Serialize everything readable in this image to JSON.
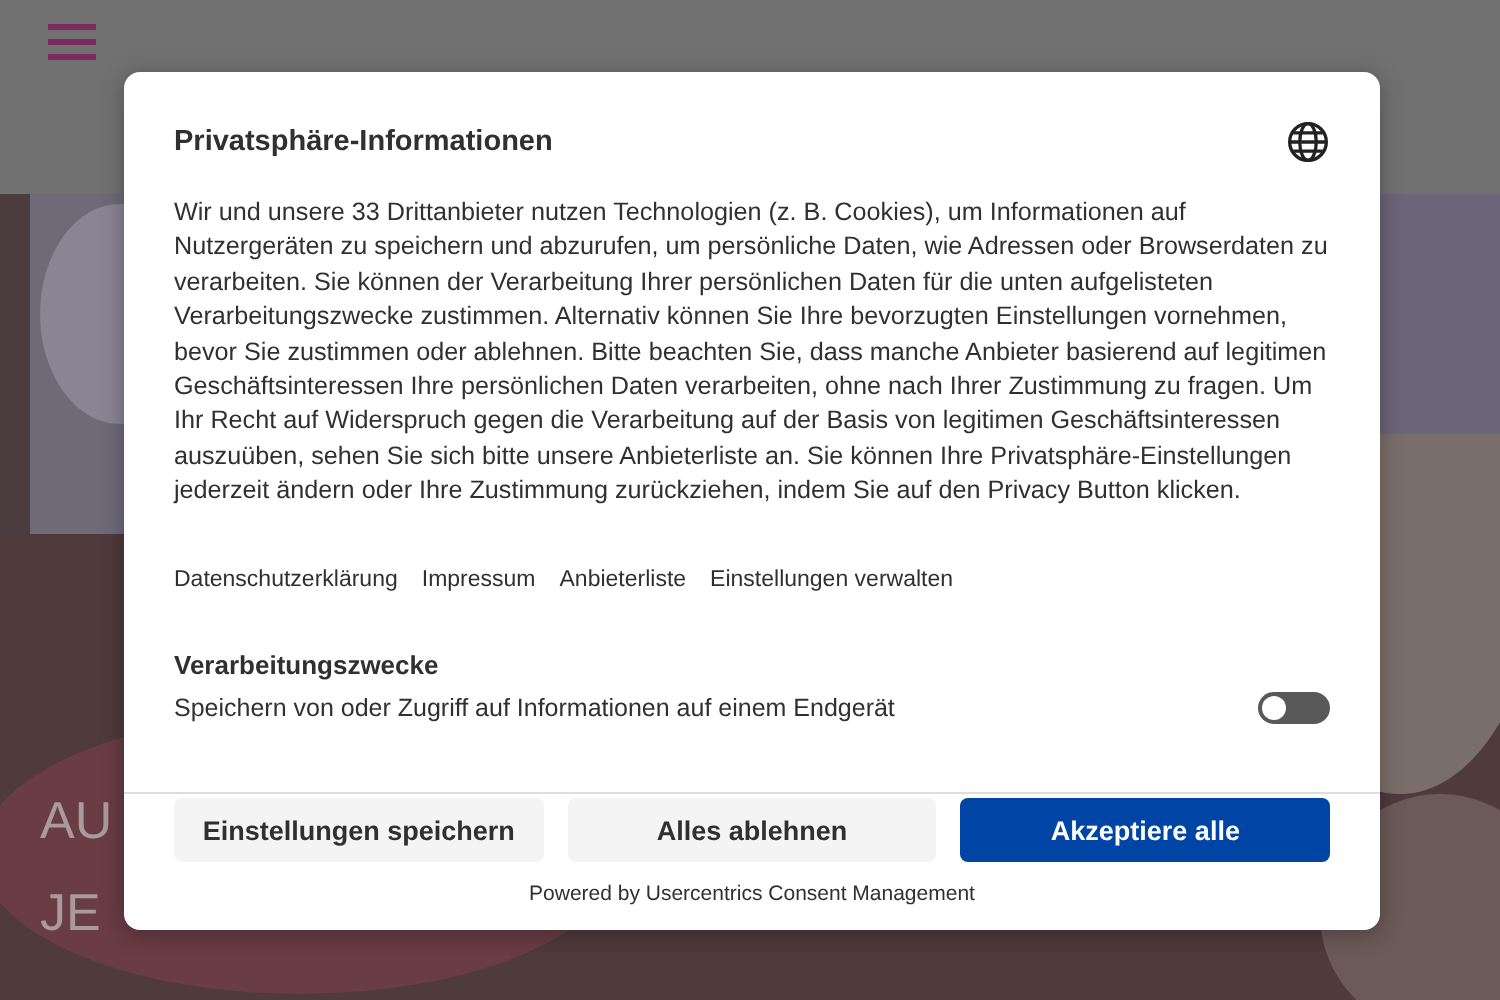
{
  "page": {
    "hero_title_lines": [
      "AU",
      "JE"
    ]
  },
  "dialog": {
    "title": "Privatsphäre-Informationen",
    "body": "Wir und unsere 33 Drittanbieter nutzen Technologien (z. B. Cookies), um Informationen auf Nutzergeräten zu speichern und abzurufen, um persönliche Daten, wie Adressen oder Browserdaten zu verarbeiten. Sie können der Verarbeitung Ihrer persönlichen Daten für die unten aufgelisteten Verarbeitungszwecke zustimmen. Alternativ können Sie Ihre bevorzugten Einstellungen vornehmen, bevor Sie zustimmen oder ablehnen. Bitte beachten Sie, dass manche Anbieter basierend auf legitimen Geschäftsinteressen Ihre persönlichen Daten verarbeiten, ohne nach Ihrer Zustimmung zu fragen. Um Ihr Recht auf Widerspruch gegen die Verarbeitung auf der Basis von legitimen Geschäftsinteressen auszuüben, sehen Sie sich bitte unsere Anbieterliste an. Sie können Ihre Privatsphäre-Einstellungen jederzeit ändern oder Ihre Zustimmung zurückziehen, indem Sie auf den Privacy Button klicken.",
    "links": [
      "Datenschutzerklärung",
      "Impressum",
      "Anbieterliste",
      "Einstellungen verwalten"
    ],
    "section_title": "Verarbeitungszwecke",
    "purposes": [
      {
        "label": "Speichern von oder Zugriff auf Informationen auf einem Endgerät",
        "on": false
      }
    ],
    "buttons": [
      {
        "label": "Einstellungen speichern",
        "kind": "secondary"
      },
      {
        "label": "Alles ablehnen",
        "kind": "secondary"
      },
      {
        "label": "Akzeptiere alle",
        "kind": "primary"
      }
    ],
    "powered_by": "Powered by Usercentrics Consent Management"
  }
}
